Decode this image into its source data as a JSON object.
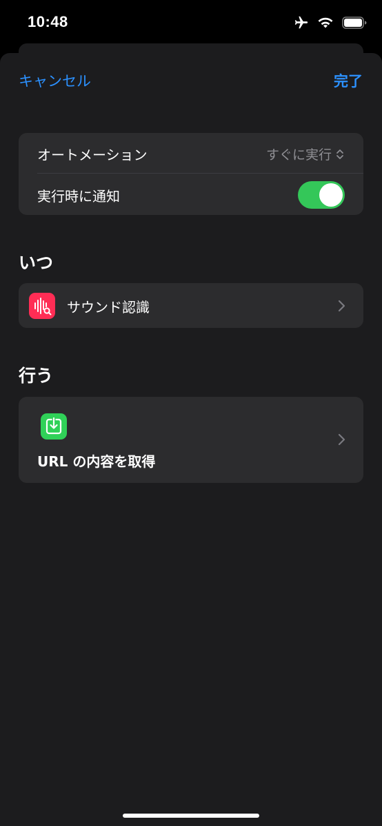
{
  "status_bar": {
    "time": "10:48",
    "icons": [
      "airplane-icon",
      "wifi-icon",
      "battery-icon"
    ]
  },
  "nav": {
    "cancel_label": "キャンセル",
    "done_label": "完了"
  },
  "settings": {
    "automation_label": "オートメーション",
    "automation_value": "すぐに実行",
    "notify_label": "実行時に通知",
    "notify_enabled": true
  },
  "when": {
    "title": "いつ",
    "trigger_label": "サウンド認識",
    "trigger_icon": "sound-recognition-icon"
  },
  "do": {
    "title": "行う",
    "action_label": "URL の内容を取得",
    "action_icon": "download-icon"
  },
  "colors": {
    "accent": "#2c91ff",
    "toggle_on": "#34c759",
    "trigger_icon_bg": "#ff2d55",
    "action_icon_bg": "#30d158"
  }
}
